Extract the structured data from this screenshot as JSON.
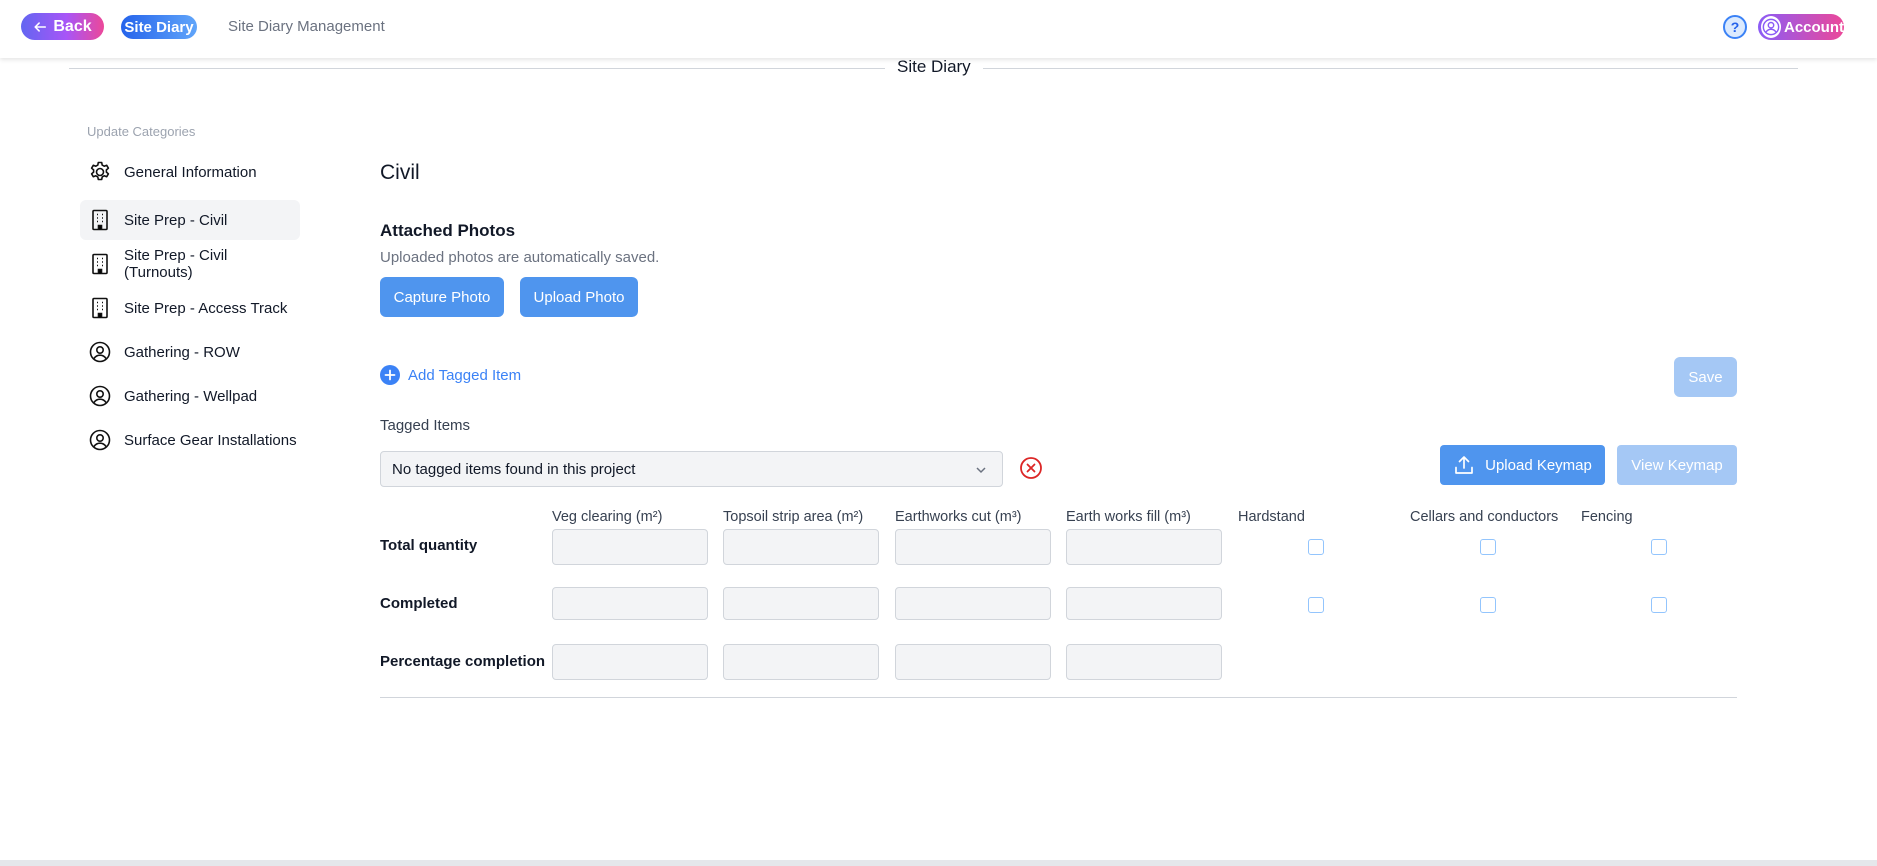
{
  "topbar": {
    "back_label": "Back",
    "brand_label": "Site Diary",
    "crumb": "Site Diary Management",
    "help_label": "?",
    "account_label": "Account"
  },
  "section": {
    "title": "Site Diary"
  },
  "sidebar": {
    "heading": "Update Categories",
    "items": [
      {
        "label": "General Information",
        "icon": "gear-icon"
      },
      {
        "label": "Site Prep - Civil",
        "icon": "building-icon",
        "active": true
      },
      {
        "label": "Site Prep - Civil (Turnouts)",
        "icon": "building-icon"
      },
      {
        "label": "Site Prep - Access Track",
        "icon": "building-icon"
      },
      {
        "label": "Gathering - ROW",
        "icon": "user-circle-icon"
      },
      {
        "label": "Gathering - Wellpad",
        "icon": "user-circle-icon"
      },
      {
        "label": "Surface Gear Installations",
        "icon": "user-circle-icon"
      }
    ]
  },
  "main": {
    "title": "Civil",
    "photos_title": "Attached Photos",
    "photos_subtitle": "Uploaded photos are automatically saved.",
    "capture_label": "Capture Photo",
    "upload_label": "Upload Photo",
    "add_tagged_label": "Add Tagged Item",
    "save_label": "Save",
    "tagged_items_label": "Tagged Items",
    "tagged_select_value": "No tagged items found in this project",
    "upload_keymap_label": "Upload Keymap",
    "view_keymap_label": "View Keymap"
  },
  "grid": {
    "columns": [
      "Veg clearing (m²)",
      "Topsoil strip area (m²)",
      "Earthworks cut (m³)",
      "Earth works fill (m³)",
      "Hardstand",
      "Cellars and conductors",
      "Fencing"
    ],
    "rows": [
      "Total quantity",
      "Completed",
      "Percentage completion"
    ]
  },
  "colors": {
    "accent_blue": "#4f95ee",
    "disabled_blue": "#a5c8f5",
    "danger_red": "#dc2626"
  }
}
